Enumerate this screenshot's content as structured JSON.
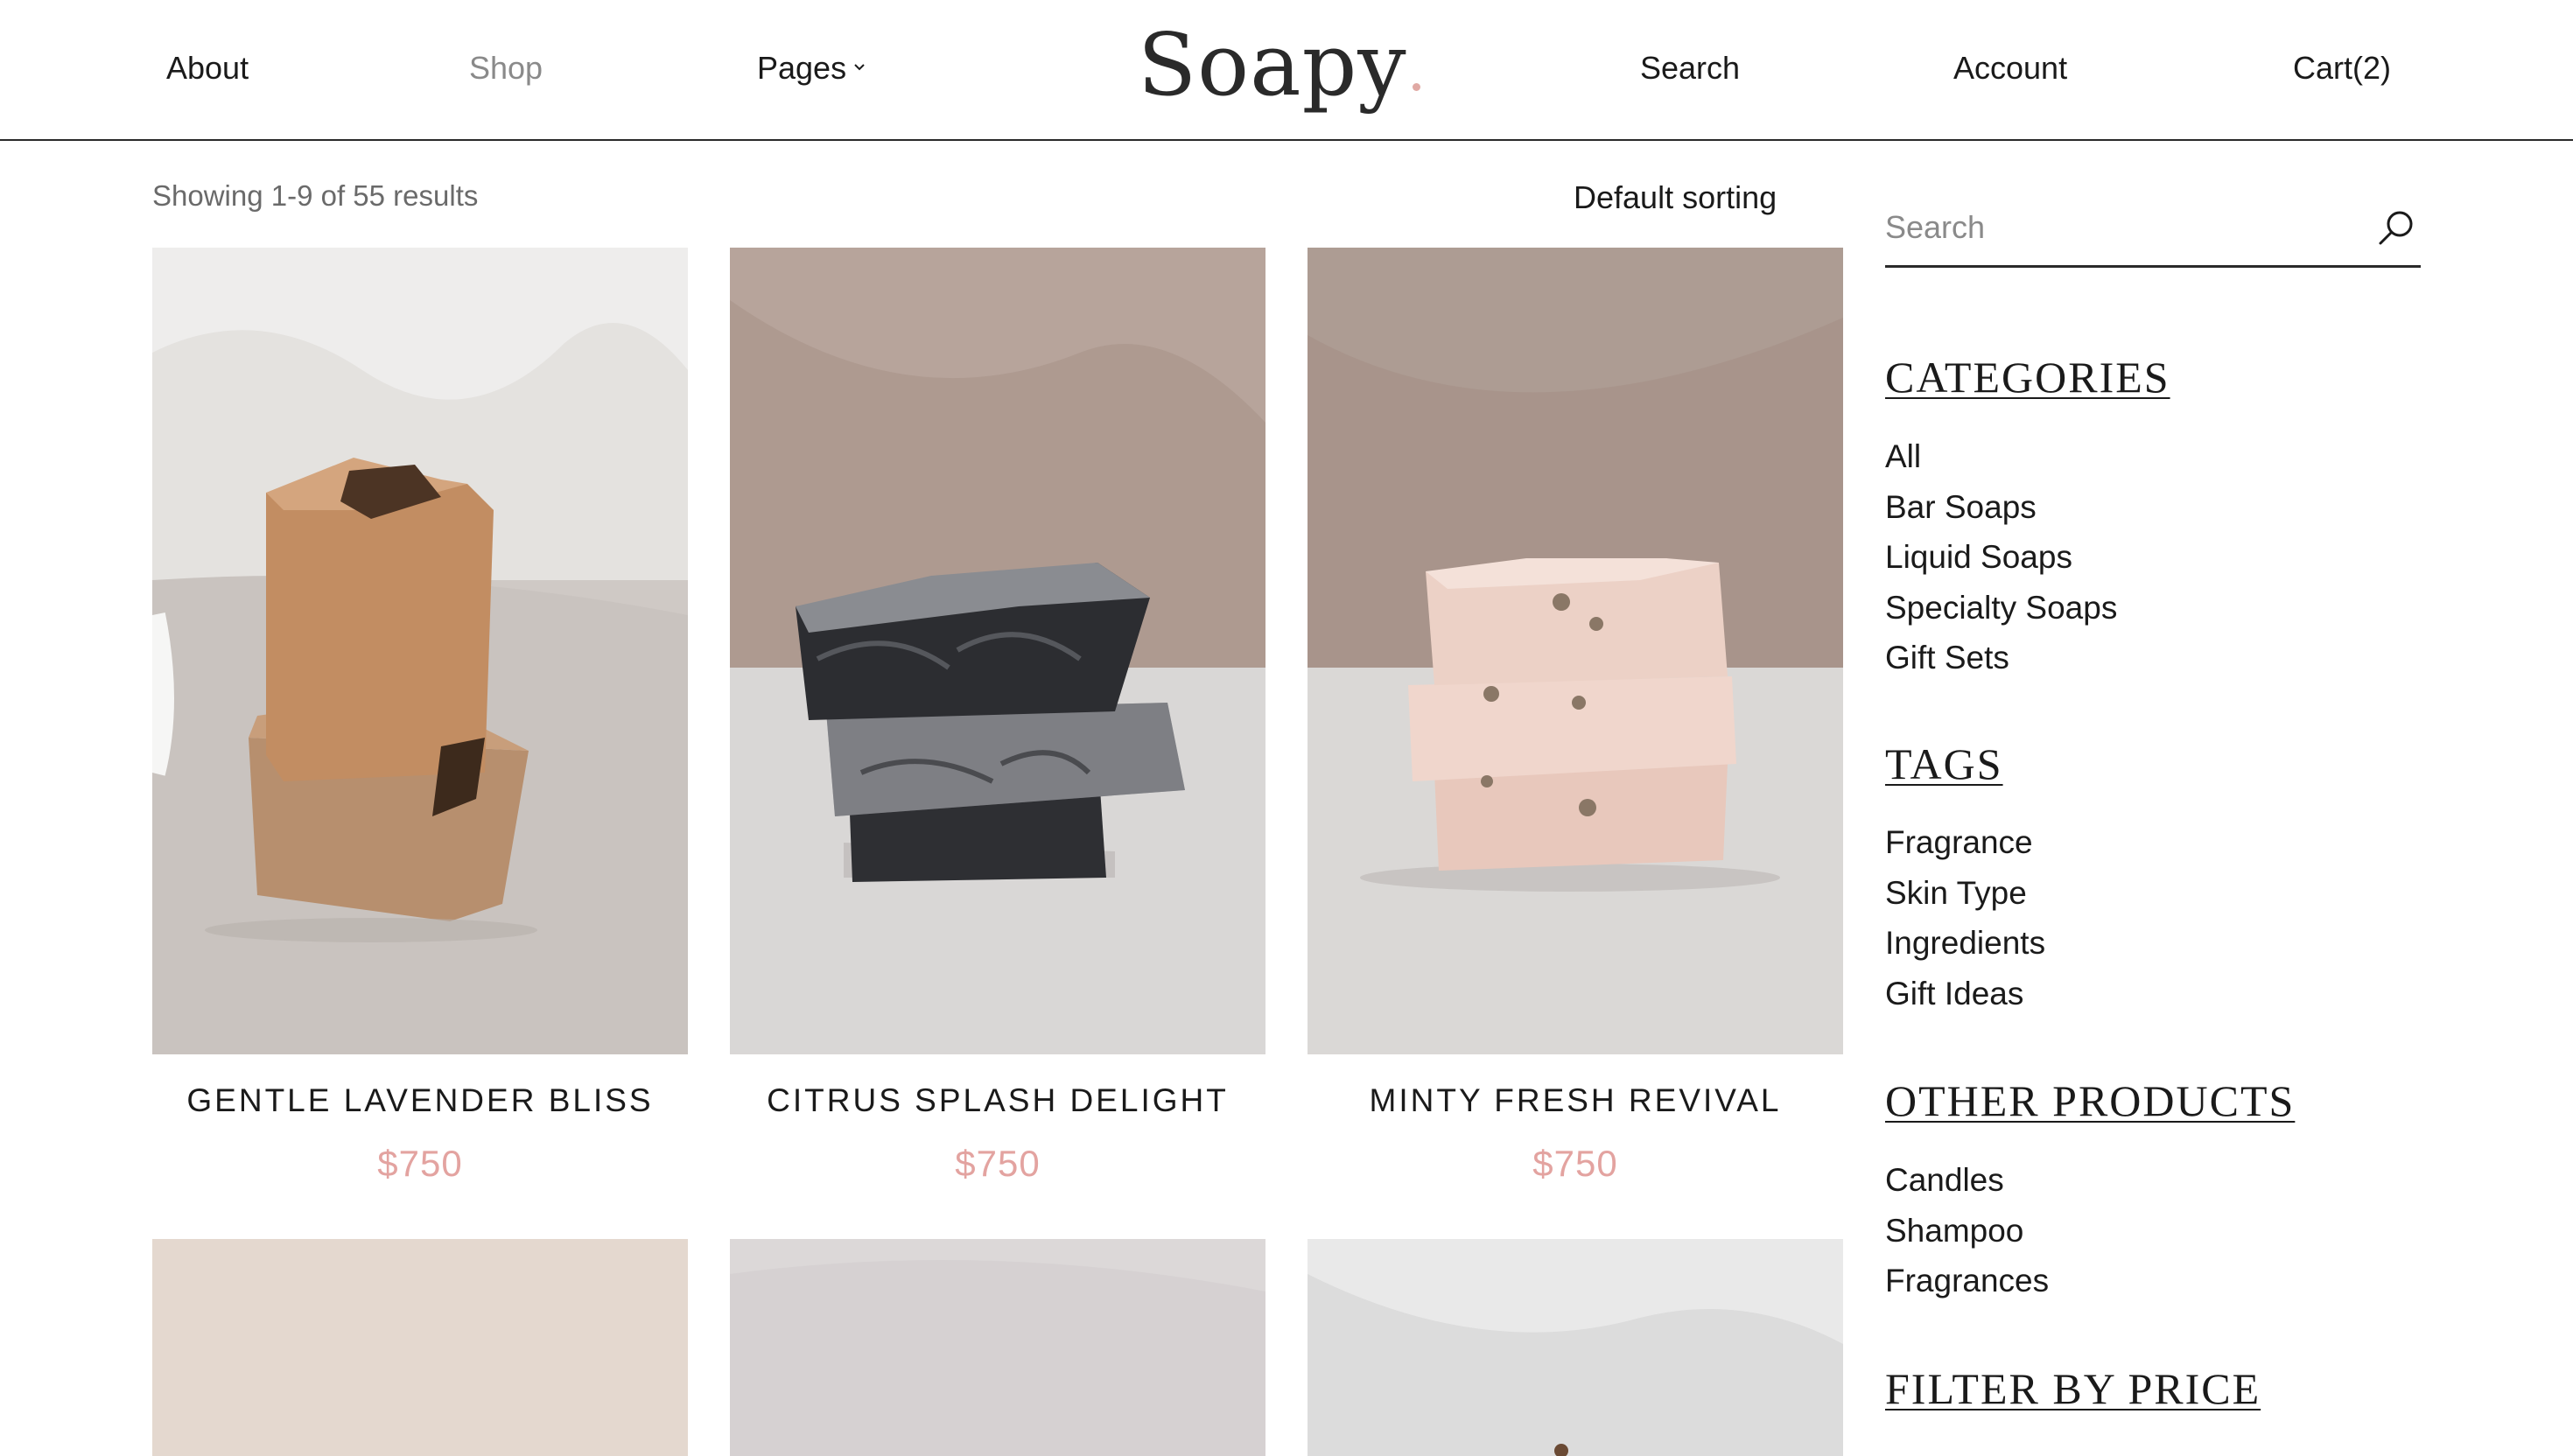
{
  "header": {
    "nav_left": [
      "About",
      "Shop",
      "Pages"
    ],
    "logo": "Soapy",
    "nav_right": [
      "Search",
      "Account",
      "Cart(2)"
    ]
  },
  "toolbar": {
    "result_count": "Showing 1-9 of 55 results",
    "sorting": "Default sorting"
  },
  "products": [
    {
      "title": "GENTLE LAVENDER BLISS",
      "price": "$750"
    },
    {
      "title": "CITRUS SPLASH DELIGHT",
      "price": "$750"
    },
    {
      "title": "MINTY FRESH REVIVAL",
      "price": "$750"
    }
  ],
  "sidebar": {
    "search_placeholder": "Search",
    "categories_heading": "CATEGORIES",
    "categories": [
      "All",
      "Bar Soaps",
      "Liquid Soaps",
      "Specialty Soaps",
      "Gift Sets"
    ],
    "tags_heading": "TAGS",
    "tags": [
      "Fragrance",
      "Skin Type",
      "Ingredients",
      "Gift Ideas"
    ],
    "other_heading": "OTHER PRODUCTS",
    "other": [
      "Candles",
      "Shampoo",
      "Fragrances"
    ],
    "price_heading": "FILTER BY PRICE"
  },
  "colors": {
    "accent_price": "#e3a3a0",
    "text": "#1a1a1a",
    "muted": "#8a8a8a"
  }
}
